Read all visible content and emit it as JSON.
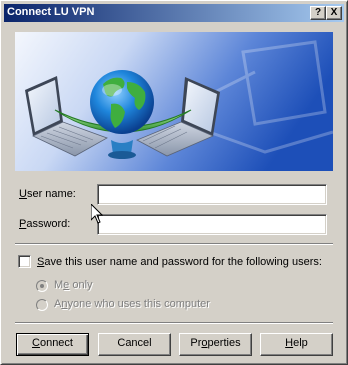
{
  "window": {
    "title": "Connect LU VPN",
    "help_glyph": "?",
    "close_glyph": "X"
  },
  "banner": {
    "illustration": "globe-between-two-laptops",
    "colors": {
      "sky_light": "#e6eefb",
      "sky_dark": "#1a4fb5",
      "globe_ocean": "#1e7fd6",
      "globe_land": "#3aa23a",
      "ring": "#2f9e2f"
    }
  },
  "form": {
    "username_label_prefix": "",
    "username_label_hot": "U",
    "username_label_rest": "ser name:",
    "username_value": "",
    "password_label_prefix": "",
    "password_label_hot": "P",
    "password_label_rest": "assword:",
    "password_value": ""
  },
  "save_credentials": {
    "label_prefix": "",
    "label_hot": "S",
    "label_rest": "ave this user name and password for the following users:",
    "checked": false,
    "options": [
      {
        "label_hot": "e",
        "label_prefix": "M",
        "label_rest": " only",
        "selected": true
      },
      {
        "label_hot": "n",
        "label_prefix": "A",
        "label_rest": "yone who uses this computer",
        "selected": false
      }
    ]
  },
  "buttons": {
    "connect_prefix": "",
    "connect_hot": "C",
    "connect_rest": "onnect",
    "cancel": "Cancel",
    "properties_prefix": "Pr",
    "properties_hot": "o",
    "properties_rest": "perties",
    "help_prefix": "",
    "help_hot": "H",
    "help_rest": "elp"
  },
  "colors": {
    "dialog_face": "#d4d0c8",
    "title_start": "#0a246a",
    "title_end": "#a6caf0"
  }
}
